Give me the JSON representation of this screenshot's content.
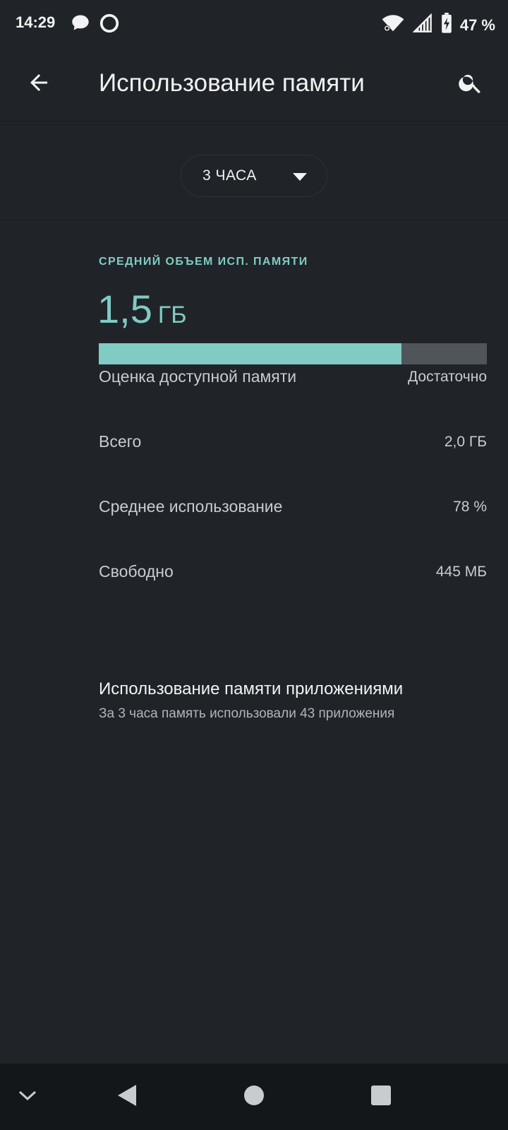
{
  "status": {
    "time": "14:29",
    "battery": "47 %",
    "icons": [
      "chat-bubble-icon",
      "app-ring-icon",
      "wifi-icon",
      "signal-icon",
      "battery-charging-icon"
    ]
  },
  "app_bar": {
    "title": "Использование памяти",
    "icons": [
      "back-arrow-icon",
      "search-icon"
    ]
  },
  "filter": {
    "period": "3 ЧАСА",
    "icon": "dropdown-caret-icon"
  },
  "summary": {
    "caption": "СРЕДНИЙ ОБЪЕМ ИСП. ПАМЯТИ",
    "value": "1,5",
    "unit": "ГБ",
    "usage_fraction": 0.78,
    "colors": {
      "accent": "#80cbc4",
      "track": "#4f555a",
      "background": "#202429"
    }
  },
  "stats": [
    {
      "label": "Оценка доступной памяти",
      "value": "Достаточно"
    },
    {
      "label": "Всего",
      "value": "2,0 ГБ"
    },
    {
      "label": "Среднее использование",
      "value": "78 %"
    },
    {
      "label": "Свободно",
      "value": "445 МБ"
    }
  ],
  "apps": {
    "title": "Использование памяти приложениями",
    "subtitle": "За 3 часа память использовали 43 приложения"
  },
  "nav": {
    "icons": [
      "collapse-chevron-icon",
      "back-triangle-icon",
      "home-circle-icon",
      "recents-square-icon"
    ]
  }
}
